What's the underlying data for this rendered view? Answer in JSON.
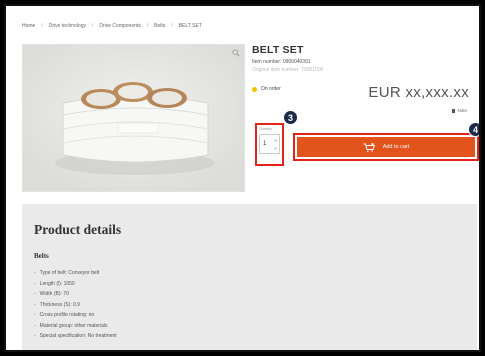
{
  "breadcrumb": [
    "Home",
    "Drive technology",
    "Drive Components",
    "Belts",
    "BELT SET"
  ],
  "product": {
    "title": "BELT SET",
    "item_number": "Item number: 0900040391",
    "original_item_number": "Original item number: 79001000",
    "availability": "On order",
    "price": "EUR xx,xxx.xx",
    "price_note": "Note"
  },
  "quantity": {
    "label": "Quantity",
    "value": "1",
    "increment_glyph": "˄",
    "decrement_glyph": "˅"
  },
  "add_to_cart": {
    "label": "Add to cart"
  },
  "badges": {
    "step3": "3",
    "step4": "4"
  },
  "details": {
    "title": "Product details",
    "section": "Belts",
    "specs": [
      "Type of belt: Conveyor belt",
      "Length (l): 1050",
      "Width (B): 70",
      "Thickness (S): 0.9",
      "Cross profile rotating: no",
      "Material group: other materials",
      "Special specification: No treatment"
    ]
  },
  "colors": {
    "accent": "#e2541c",
    "highlight": "#e32219",
    "badge": "#1c2b4a",
    "availability_dot": "#f2c200"
  },
  "icons": {
    "zoom": "zoom-icon",
    "cart": "cart-icon",
    "info": "info-icon",
    "availability": "status-dot-icon"
  }
}
